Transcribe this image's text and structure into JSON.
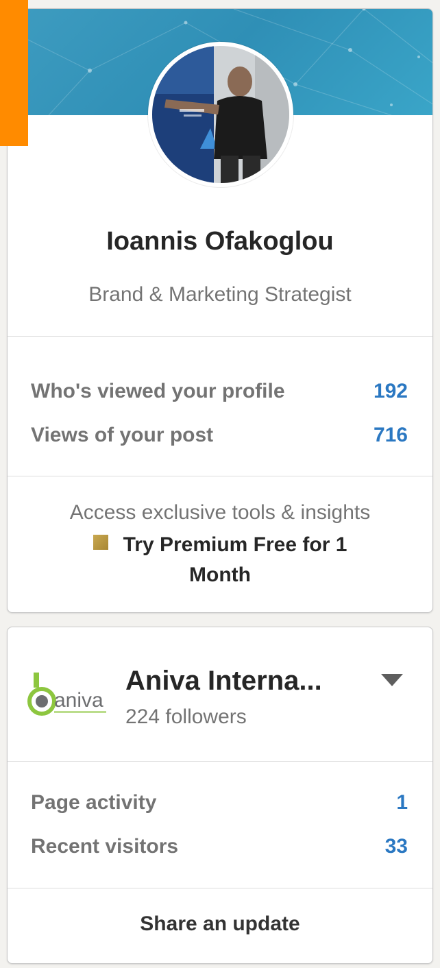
{
  "profile": {
    "name": "Ioannis Ofakoglou",
    "headline": "Brand & Marketing Strategist",
    "stats": [
      {
        "label": "Who's viewed your profile",
        "value": "192"
      },
      {
        "label": "Views of your post",
        "value": "716"
      }
    ],
    "premium": {
      "hint": "Access exclusive tools & insights",
      "cta": "Try Premium Free for 1 Month"
    }
  },
  "page": {
    "name": "Aniva Interna...",
    "followers": "224 followers",
    "logo_text": "aniva",
    "stats": [
      {
        "label": "Page activity",
        "value": "1"
      },
      {
        "label": "Recent visitors",
        "value": "33"
      }
    ],
    "share_label": "Share an update"
  },
  "colors": {
    "accent": "#2b78c2",
    "banner": "#3e9cc0",
    "corner_tab": "#ff8b00",
    "premium_gold": "#c9a850"
  },
  "icons": {
    "premium": "premium-square-icon",
    "caret": "caret-down-icon"
  }
}
